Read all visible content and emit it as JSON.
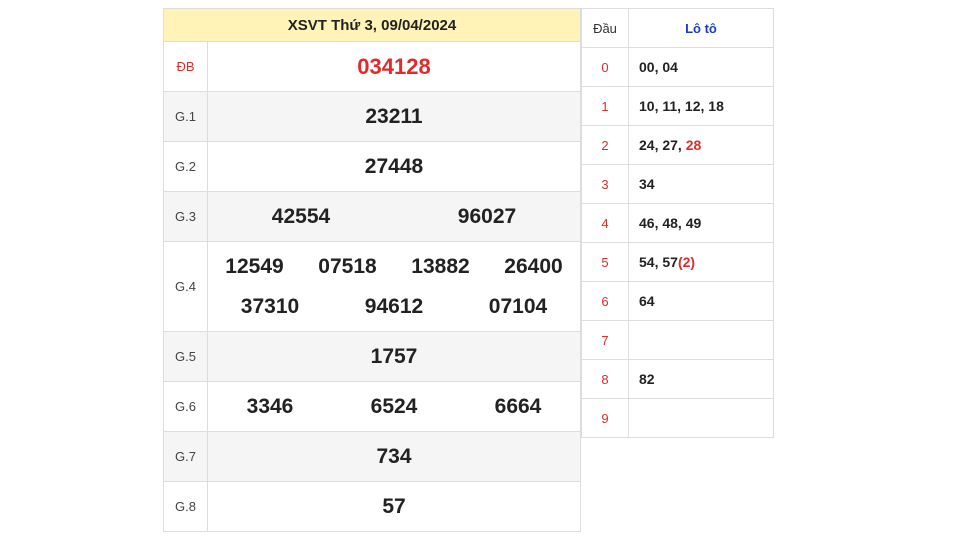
{
  "title": "XSVT Thứ 3, 09/04/2024",
  "prizes": {
    "db": {
      "label": "ĐB",
      "numbers": [
        "034128"
      ]
    },
    "g1": {
      "label": "G.1",
      "numbers": [
        "23211"
      ]
    },
    "g2": {
      "label": "G.2",
      "numbers": [
        "27448"
      ]
    },
    "g3": {
      "label": "G.3",
      "numbers": [
        "42554",
        "96027"
      ]
    },
    "g4": {
      "label": "G.4",
      "numbers": [
        "12549",
        "07518",
        "13882",
        "26400",
        "37310",
        "94612",
        "07104"
      ]
    },
    "g5": {
      "label": "G.5",
      "numbers": [
        "1757"
      ]
    },
    "g6": {
      "label": "G.6",
      "numbers": [
        "3346",
        "6524",
        "6664"
      ]
    },
    "g7": {
      "label": "G.7",
      "numbers": [
        "734"
      ]
    },
    "g8": {
      "label": "G.8",
      "numbers": [
        "57"
      ]
    }
  },
  "loto": {
    "head_dau": "Đầu",
    "head_loto": "Lô tô",
    "rows": [
      {
        "dau": "0",
        "tails": "00, 04"
      },
      {
        "dau": "1",
        "tails": "10, 11, 12, 18"
      },
      {
        "dau": "2",
        "tails": "24, 27, ",
        "highlight": "28"
      },
      {
        "dau": "3",
        "tails": "34"
      },
      {
        "dau": "4",
        "tails": "46, 48, 49"
      },
      {
        "dau": "5",
        "tails": "54, 57",
        "highlight": "(2)"
      },
      {
        "dau": "6",
        "tails": "64"
      },
      {
        "dau": "7",
        "tails": ""
      },
      {
        "dau": "8",
        "tails": "82"
      },
      {
        "dau": "9",
        "tails": ""
      }
    ]
  },
  "colors": {
    "highlight": "#e02b2b",
    "header_bg": "#fff3b8",
    "loto_head": "#1a3cc8"
  }
}
